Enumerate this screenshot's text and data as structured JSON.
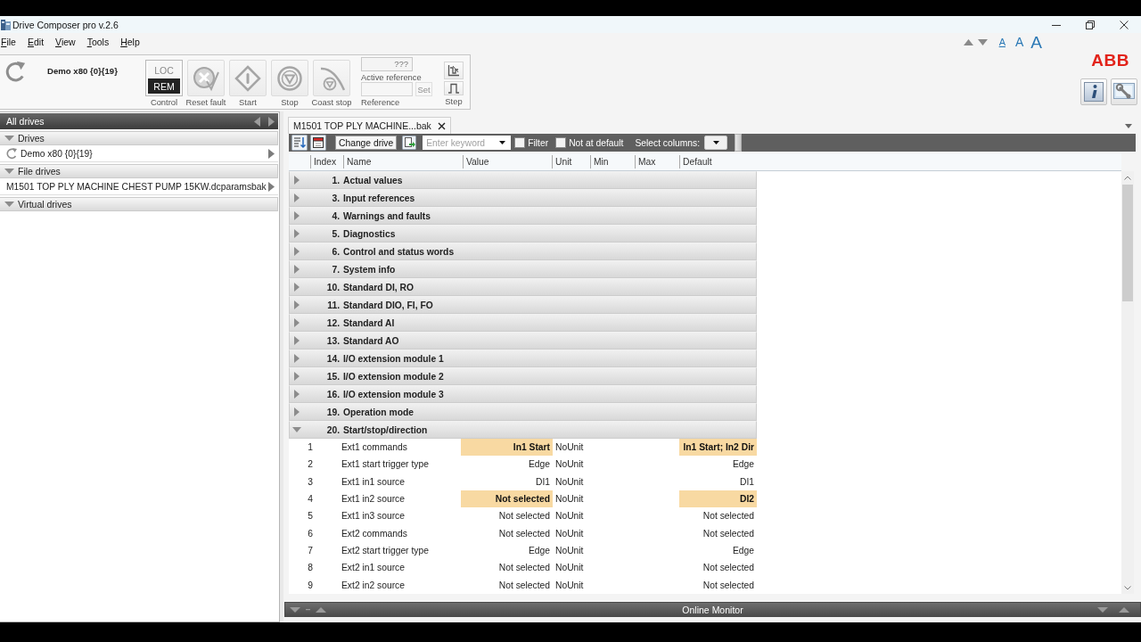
{
  "window": {
    "title": "Drive Composer pro v.2.6"
  },
  "menu": [
    {
      "label": "File"
    },
    {
      "label": "Edit"
    },
    {
      "label": "View"
    },
    {
      "label": "Tools"
    },
    {
      "label": "Help"
    }
  ],
  "font_sizes": [
    {
      "label": "A",
      "selected": true
    },
    {
      "label": "A",
      "selected": false
    },
    {
      "label": "A",
      "selected": false
    }
  ],
  "toolbar": {
    "drive_name": "Demo x80 {0}{19}",
    "control": {
      "label": "Control",
      "modes": [
        {
          "label": "LOC",
          "selected": false
        },
        {
          "label": "REM",
          "selected": true
        }
      ]
    },
    "actions": [
      {
        "kind": "reset",
        "label": "Reset fault",
        "disabled": true
      },
      {
        "kind": "start",
        "label": "Start",
        "disabled": true
      },
      {
        "kind": "stop",
        "label": "Stop",
        "disabled": true
      },
      {
        "kind": "coast",
        "label": "Coast stop",
        "disabled": true
      }
    ],
    "reference": {
      "active_value": "???",
      "active_label": "Active reference",
      "set_button": {
        "label": "Set",
        "disabled": true
      },
      "label": "Reference"
    },
    "step": {
      "label": "Step"
    }
  },
  "logo": "ABB",
  "drives_panel": {
    "title": "All drives",
    "sections": [
      {
        "title": "Drives",
        "expanded": true,
        "items": [
          {
            "kind": "online",
            "label": "Demo x80 {0}{19}"
          }
        ]
      },
      {
        "title": "File drives",
        "expanded": true,
        "items": [
          {
            "kind": "file",
            "label": "M1501 TOP PLY MACHINE CHEST PUMP 15KW.dcparamsbak"
          }
        ]
      },
      {
        "title": "Virtual drives",
        "expanded": true
      }
    ]
  },
  "tabs": [
    {
      "label": "M1501 TOP PLY MACHINE...bak",
      "selected": true
    }
  ],
  "parameter_toolbar": {
    "change_drive": "Change drive",
    "search": {
      "placeholder": "Enter keyword"
    },
    "checkboxes": [
      {
        "label": "Filter",
        "checked": false
      },
      {
        "label": "Not at default",
        "checked": false
      }
    ],
    "select_columns": "Select columns:"
  },
  "table": {
    "columns": [
      "Index",
      "Name",
      "Value",
      "Unit",
      "Min",
      "Max",
      "Default"
    ],
    "groups": [
      {
        "number": "1.",
        "title": "Actual values",
        "expanded": false
      },
      {
        "number": "3.",
        "title": "Input references",
        "expanded": false
      },
      {
        "number": "4.",
        "title": "Warnings and faults",
        "expanded": false
      },
      {
        "number": "5.",
        "title": "Diagnostics",
        "expanded": false
      },
      {
        "number": "6.",
        "title": "Control and status words",
        "expanded": false
      },
      {
        "number": "7.",
        "title": "System info",
        "expanded": false
      },
      {
        "number": "10.",
        "title": "Standard DI, RO",
        "expanded": false
      },
      {
        "number": "11.",
        "title": "Standard DIO, FI, FO",
        "expanded": false
      },
      {
        "number": "12.",
        "title": "Standard AI",
        "expanded": false
      },
      {
        "number": "13.",
        "title": "Standard AO",
        "expanded": false
      },
      {
        "number": "14.",
        "title": "I/O extension module 1",
        "expanded": false
      },
      {
        "number": "15.",
        "title": "I/O extension module 2",
        "expanded": false
      },
      {
        "number": "16.",
        "title": "I/O extension module 3",
        "expanded": false
      },
      {
        "number": "19.",
        "title": "Operation mode",
        "expanded": false
      },
      {
        "number": "20.",
        "title": "Start/stop/direction",
        "expanded": true,
        "parameters": [
          {
            "index": "1",
            "name": "Ext1 commands",
            "value": "In1 Start",
            "unit": "NoUnit",
            "default": "In1 Start; In2 Dir",
            "modified": true
          },
          {
            "index": "2",
            "name": "Ext1 start trigger type",
            "value": "Edge",
            "unit": "NoUnit",
            "default": "Edge",
            "modified": false
          },
          {
            "index": "3",
            "name": "Ext1 in1 source",
            "value": "DI1",
            "unit": "NoUnit",
            "default": "DI1",
            "modified": false
          },
          {
            "index": "4",
            "name": "Ext1 in2 source",
            "value": "Not selected",
            "unit": "NoUnit",
            "default": "DI2",
            "modified": true
          },
          {
            "index": "5",
            "name": "Ext1 in3 source",
            "value": "Not selected",
            "unit": "NoUnit",
            "default": "Not selected",
            "modified": false
          },
          {
            "index": "6",
            "name": "Ext2 commands",
            "value": "Not selected",
            "unit": "NoUnit",
            "default": "Not selected",
            "modified": false
          },
          {
            "index": "7",
            "name": "Ext2 start trigger type",
            "value": "Edge",
            "unit": "NoUnit",
            "default": "Edge",
            "modified": false
          },
          {
            "index": "8",
            "name": "Ext2 in1 source",
            "value": "Not selected",
            "unit": "NoUnit",
            "default": "Not selected",
            "modified": false
          },
          {
            "index": "9",
            "name": "Ext2 in2 source",
            "value": "Not selected",
            "unit": "NoUnit",
            "default": "Not selected",
            "modified": false
          }
        ]
      }
    ]
  },
  "online_monitor": {
    "title": "Online Monitor"
  }
}
